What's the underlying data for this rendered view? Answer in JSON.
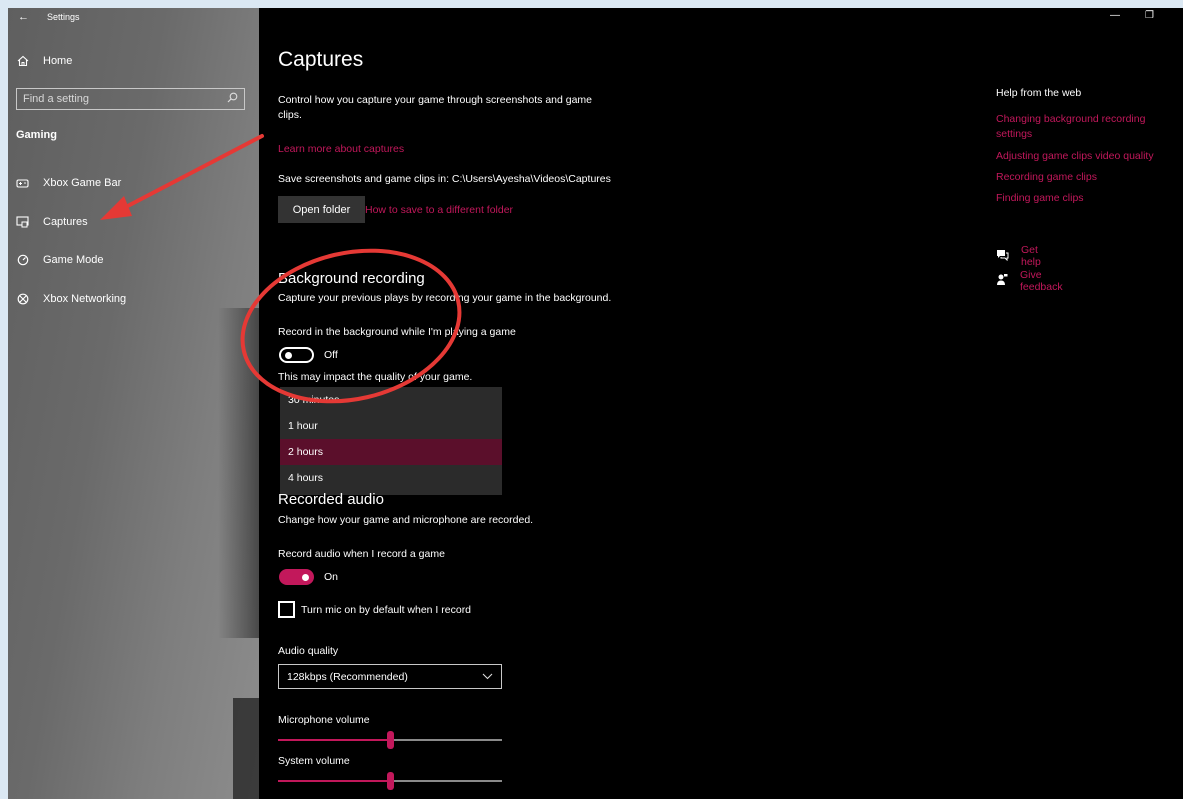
{
  "window": {
    "title": "Settings",
    "minimize_glyph": "—",
    "restore_glyph": "❐"
  },
  "sidebar": {
    "back_icon": "←",
    "home": {
      "label": "Home",
      "icon": "home-icon"
    },
    "search_placeholder": "Find a setting",
    "section": "Gaming",
    "items": [
      {
        "label": "Xbox Game Bar",
        "icon": "game-bar-icon"
      },
      {
        "label": "Captures",
        "icon": "captures-icon"
      },
      {
        "label": "Game Mode",
        "icon": "game-mode-icon"
      },
      {
        "label": "Xbox Networking",
        "icon": "xbox-icon"
      }
    ]
  },
  "main": {
    "title": "Captures",
    "intro_line1": "Control how you capture your game through screenshots and game",
    "intro_line2": "clips.",
    "learn_more": "Learn more about captures",
    "save_path": "Save screenshots and game clips in: C:\\Users\\Ayesha\\Videos\\Captures",
    "open_folder": "Open folder",
    "how_to_save": "How to save to a different folder",
    "bg_recording": {
      "heading": "Background recording",
      "desc": "Capture your previous plays by recording your game in the background.",
      "toggle_label": "Record in the background while I'm playing a game",
      "toggle_state": "Off",
      "impact": "This may impact the quality of your game.",
      "options": [
        "30 minutes",
        "1 hour",
        "2 hours",
        "4 hours"
      ],
      "selected": "2 hours"
    },
    "audio": {
      "heading": "Recorded audio",
      "desc": "Change how your game and microphone are recorded.",
      "toggle_label": "Record audio when I record a game",
      "toggle_state": "On",
      "mic_checkbox": "Turn mic on by default when I record",
      "quality_label": "Audio quality",
      "quality_value": "128kbps (Recommended)",
      "mic_volume_label": "Microphone volume",
      "mic_volume_level": 0.5,
      "system_volume_label": "System volume",
      "system_volume_level": 0.5
    }
  },
  "help": {
    "title": "Help from the web",
    "links": [
      "Changing background recording settings",
      "Adjusting game clips video quality",
      "Recording game clips",
      "Finding game clips"
    ],
    "get_help": "Get help",
    "give_feedback": "Give feedback"
  },
  "colors": {
    "accent": "#c2185b",
    "annotation": "#e53935"
  }
}
